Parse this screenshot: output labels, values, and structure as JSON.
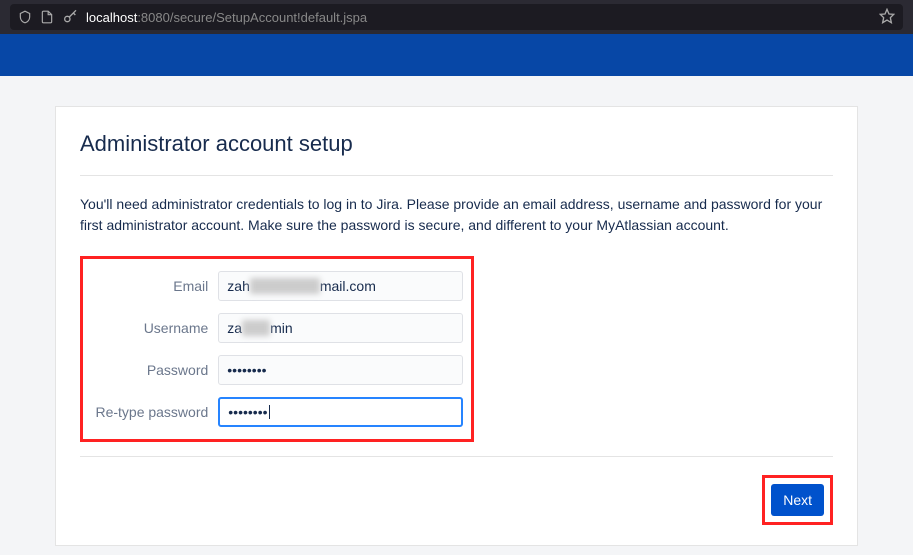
{
  "browser": {
    "url_host": "localhost",
    "url_path": ":8080/secure/SetupAccount!default.jspa"
  },
  "page": {
    "title": "Administrator account setup",
    "intro": "You'll need administrator credentials to log in to Jira. Please provide an email address, username and password for your first administrator account. Make sure the password is secure, and different to your MyAtlassian account."
  },
  "form": {
    "email_label": "Email",
    "email_value_prefix": "zah",
    "email_value_suffix": "mail.com",
    "username_label": "Username",
    "username_value_prefix": "za",
    "username_value_suffix": "min",
    "password_label": "Password",
    "password_value": "••••••••",
    "retype_label": "Re-type password",
    "retype_value": "••••••••"
  },
  "buttons": {
    "next": "Next"
  }
}
